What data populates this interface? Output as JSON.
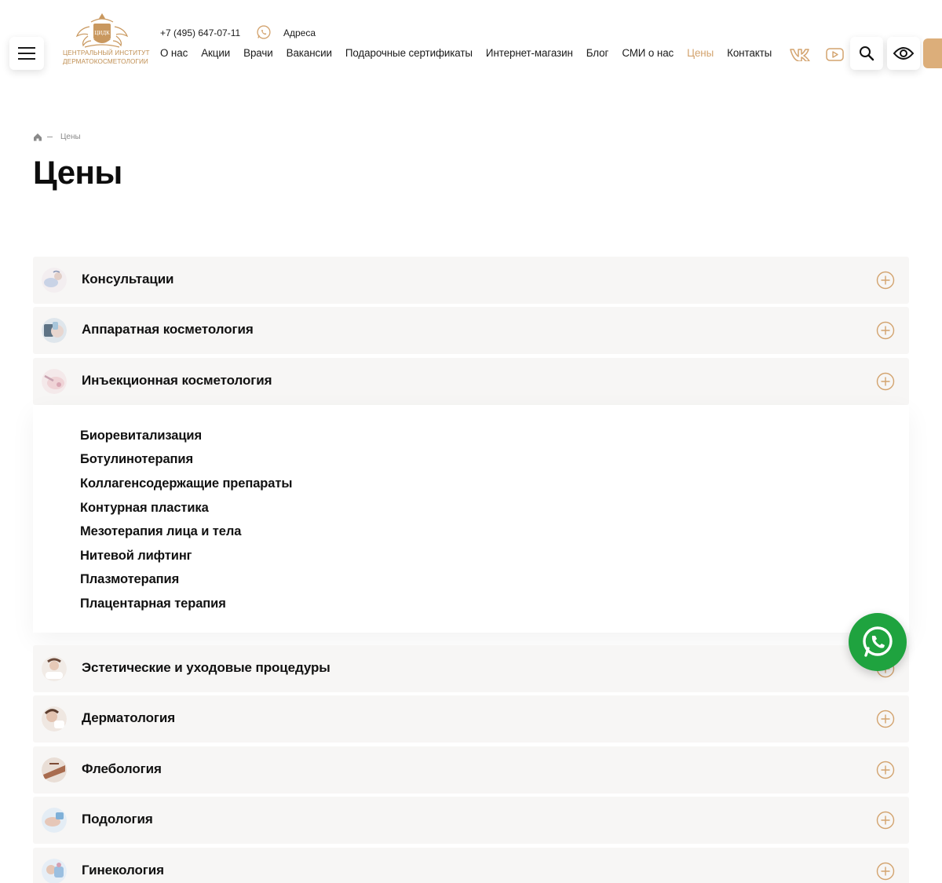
{
  "header": {
    "logo": {
      "monogram": "ЦИДК",
      "line1": "ЦЕНТРАЛЬНЫЙ ИНСТИТУТ",
      "line2": "ДЕРМАТОКОСМЕТОЛОГИИ"
    },
    "phone": "+7 (495) 647-07-11",
    "address_label": "Адреса",
    "nav": [
      {
        "label": "О нас",
        "active": false
      },
      {
        "label": "Акции",
        "active": false
      },
      {
        "label": "Врачи",
        "active": false
      },
      {
        "label": "Вакансии",
        "active": false
      },
      {
        "label": "Подарочные сертификаты",
        "active": false
      },
      {
        "label": "Интернет-магазин",
        "active": false
      },
      {
        "label": "Блог",
        "active": false
      },
      {
        "label": "СМИ о нас",
        "active": false
      },
      {
        "label": "Цены",
        "active": true
      },
      {
        "label": "Контакты",
        "active": false
      }
    ],
    "icons": [
      "menu-icon",
      "whatsapp-icon",
      "vk-icon",
      "youtube-icon",
      "search-icon",
      "eye-icon"
    ]
  },
  "breadcrumb": {
    "home_icon": "home-icon",
    "current": "Цены"
  },
  "page": {
    "title": "Цены"
  },
  "accordion": {
    "items": [
      {
        "label": "Консультации",
        "expanded": false
      },
      {
        "label": "Аппаратная косметология",
        "expanded": false
      },
      {
        "label": "Инъекционная косметология",
        "expanded": true
      },
      {
        "label": "Эстетические и уходовые процедуры",
        "expanded": false
      },
      {
        "label": "Дерматология",
        "expanded": false
      },
      {
        "label": "Флебология",
        "expanded": false
      },
      {
        "label": "Подология",
        "expanded": false
      },
      {
        "label": "Гинекология",
        "expanded": false
      }
    ],
    "expanded_subitems": [
      "Биоревитализация",
      "Ботулинотерапия",
      "Коллагенсодержащие препараты",
      "Контурная пластика",
      "Мезотерапия лица и тела",
      "Нитевой лифтинг",
      "Плазмотерапия",
      "Плацентарная терапия"
    ]
  },
  "colors": {
    "accent": "#d3a36e",
    "row_bg": "#f7f6f5",
    "whatsapp": "#1fa33f",
    "text": "#111111"
  }
}
